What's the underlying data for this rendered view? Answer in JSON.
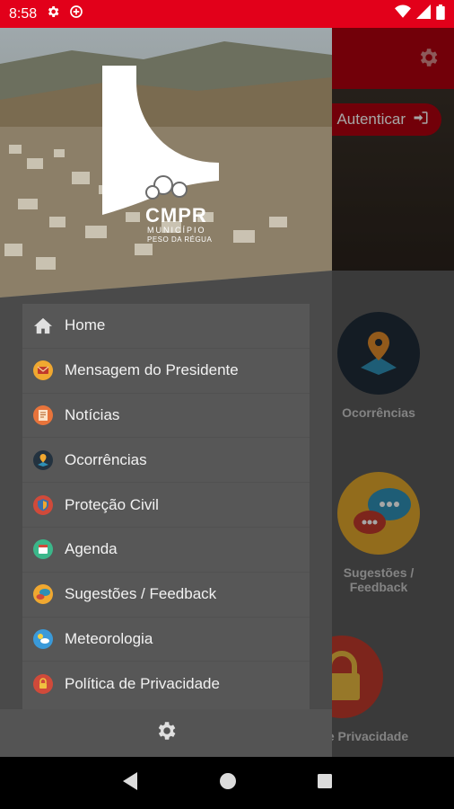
{
  "status_bar": {
    "time": "8:58",
    "icons": [
      "gear-icon",
      "data-saver-icon",
      "wifi-icon",
      "signal-icon",
      "battery-icon"
    ]
  },
  "background": {
    "auth_button_label": "Autenticar",
    "tiles": [
      {
        "label_line1": "Ocorrências",
        "label_line2": ""
      },
      {
        "label_line1": "Sugestões /",
        "label_line2": "Feedback"
      },
      {
        "label_line1": "e Privacidade",
        "label_line2": ""
      }
    ]
  },
  "drawer": {
    "logo_text": "CMPR",
    "logo_subtitle_1": "MUNICÍPIO",
    "logo_subtitle_2": "PESO DA RÉGUA",
    "menu": [
      {
        "label": "Home",
        "icon": "home-icon"
      },
      {
        "label": "Mensagem do Presidente",
        "icon": "envelope-icon"
      },
      {
        "label": "Notícias",
        "icon": "newspaper-icon"
      },
      {
        "label": "Ocorrências",
        "icon": "occurrence-icon"
      },
      {
        "label": "Proteção Civil",
        "icon": "shield-icon"
      },
      {
        "label": "Agenda",
        "icon": "calendar-icon"
      },
      {
        "label": "Sugestões / Feedback",
        "icon": "feedback-icon"
      },
      {
        "label": "Meteorologia",
        "icon": "weather-icon"
      },
      {
        "label": "Política de Privacidade",
        "icon": "lock-icon"
      }
    ]
  },
  "colors": {
    "brand_red": "#e2001a",
    "drawer_bg": "#4a4a4a",
    "menu_bg": "#575757"
  }
}
